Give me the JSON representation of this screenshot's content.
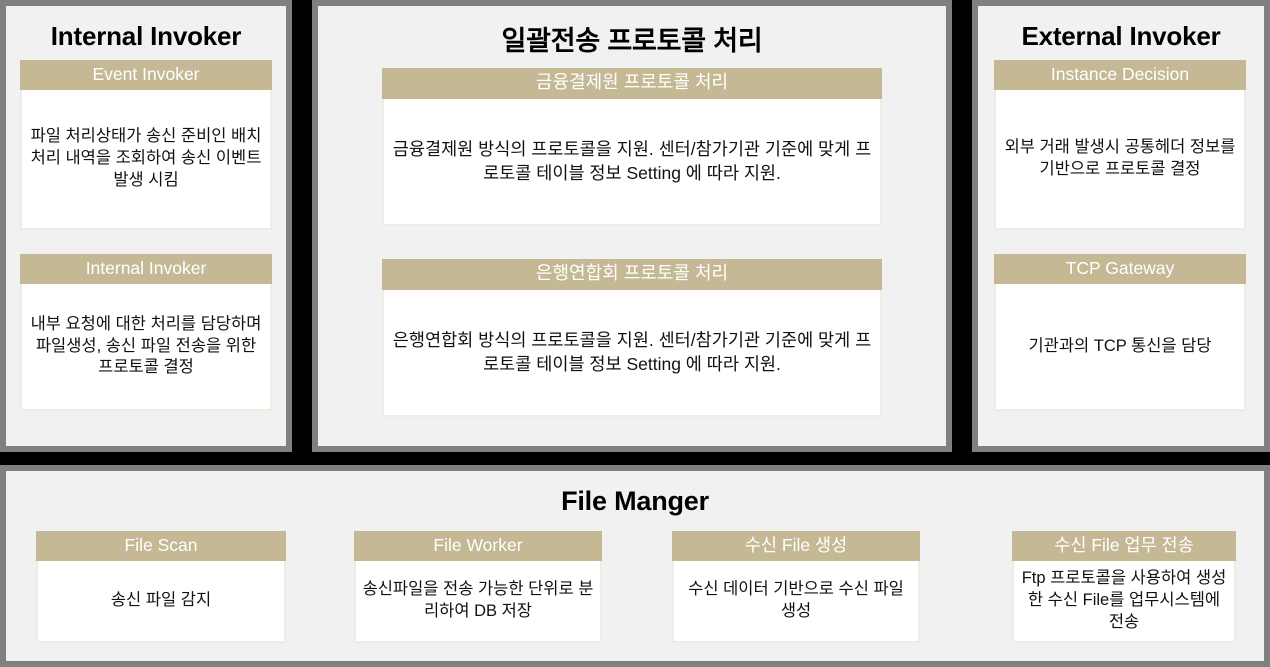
{
  "panels": {
    "left": {
      "title": "Internal Invoker",
      "cards": [
        {
          "header": "Event Invoker",
          "body": "파일 처리상태가 송신 준비인 배치 처리 내역을 조회하여 송신 이벤트 발생 시킴"
        },
        {
          "header": "Internal Invoker",
          "body": "내부 요청에 대한 처리를 담당하며 파일생성, 송신 파일 전송을 위한 프로토콜 결정"
        }
      ]
    },
    "center": {
      "title": "일괄전송 프로토콜 처리",
      "cards": [
        {
          "header": "금융결제원 프로토콜 처리",
          "body": "금융결제원 방식의 프로토콜을 지원. 센터/참가기관 기준에 맞게 프로토콜 테이블 정보 Setting 에 따라 지원."
        },
        {
          "header": "은행연합회 프로토콜 처리",
          "body": "은행연합회 방식의 프로토콜을 지원. 센터/참가기관 기준에 맞게 프로토콜 테이블 정보 Setting 에 따라 지원."
        }
      ]
    },
    "right": {
      "title": "External Invoker",
      "cards": [
        {
          "header": "Instance Decision",
          "body": "외부 거래 발생시 공통헤더 정보를 기반으로 프로토콜 결정"
        },
        {
          "header": "TCP Gateway",
          "body": "기관과의 TCP 통신을 담당"
        }
      ]
    },
    "bottom": {
      "title": "File Manger",
      "cards": [
        {
          "header": "File Scan",
          "body": "송신 파일 감지"
        },
        {
          "header": "File Worker",
          "body": "송신파일을 전송 가능한 단위로 분리하여 DB 저장"
        },
        {
          "header": "수신 File 생성",
          "body": "수신 데이터 기반으로 수신 파일 생성"
        },
        {
          "header": "수신 File 업무 전송",
          "body": "Ftp 프로토콜을 사용하여 생성한 수신 File를 업무시스템에 전송"
        }
      ]
    }
  },
  "colors": {
    "page_background": "#000000",
    "panel_background": "#f1f1f1",
    "panel_border": "#808080",
    "card_header": "#c4b994",
    "card_header_text": "#ffffff",
    "card_body": "#ffffff",
    "card_body_border": "#efece1",
    "text": "#111111"
  }
}
